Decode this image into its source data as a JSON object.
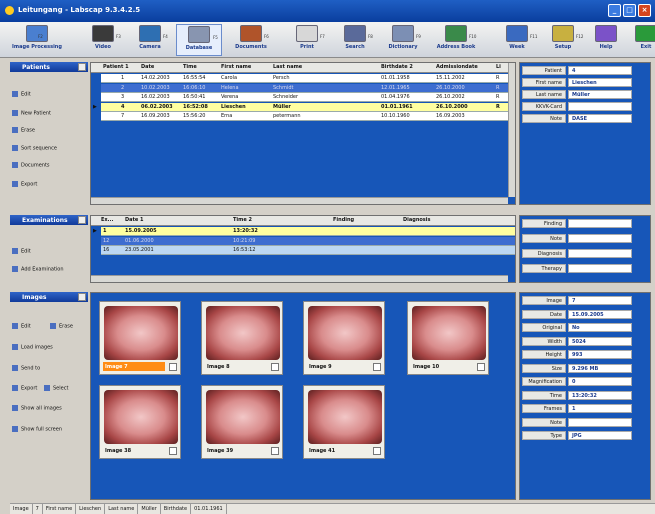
{
  "window": {
    "title": "Leitungang - Labscap 9.3.4.2.5"
  },
  "toolbar": [
    {
      "label": "Image Processing",
      "key": "F2",
      "icon": "image-processing-icon"
    },
    {
      "label": "Video",
      "key": "F3",
      "icon": "video-camera-icon"
    },
    {
      "label": "Camera",
      "key": "F4",
      "icon": "camera-icon"
    },
    {
      "label": "Database",
      "key": "F5",
      "icon": "database-icon"
    },
    {
      "label": "Documents",
      "key": "F6",
      "icon": "documents-icon"
    },
    {
      "label": "Print",
      "key": "F7",
      "icon": "print-icon"
    },
    {
      "label": "Search",
      "key": "F8",
      "icon": "search-icon"
    },
    {
      "label": "Dictionary",
      "key": "F9",
      "icon": "dictionary-icon"
    },
    {
      "label": "Address Book",
      "key": "F10",
      "icon": "address-book-icon"
    },
    {
      "label": "Week",
      "key": "F11",
      "icon": "calendar-icon"
    },
    {
      "label": "Setup",
      "key": "F12",
      "icon": "setup-icon"
    },
    {
      "label": "Help",
      "key": "",
      "icon": "help-icon"
    },
    {
      "label": "Exit",
      "key": "",
      "icon": "exit-icon"
    }
  ],
  "patients": {
    "header": "Patients",
    "nav": [
      {
        "label": "Edit",
        "icon": "edit-icon"
      },
      {
        "label": "New Patient",
        "icon": "new-patient-icon"
      },
      {
        "label": "Erase",
        "icon": "erase-icon"
      },
      {
        "label": "Sort sequence",
        "icon": "sort-icon"
      },
      {
        "label": "Documents",
        "icon": "documents-icon"
      },
      {
        "label": "Export",
        "icon": "export-icon"
      }
    ],
    "columns": [
      "Patient 1",
      "Date",
      "Time",
      "First name",
      "Last name",
      "Birthdate 2",
      "Admissiondate",
      "Li"
    ],
    "rows": [
      {
        "id": "1",
        "date": "14.02.2003",
        "time": "16:55:54",
        "first": "Carola",
        "last": "Persch",
        "birth": "01.01.1958",
        "adm": "15.11.2002",
        "li": "R",
        "style": "white"
      },
      {
        "id": "2",
        "date": "10.02.2003",
        "time": "16:06:10",
        "first": "Helena",
        "last": "Schmidt",
        "birth": "12.01.1965",
        "adm": "26.10.2000",
        "li": "R",
        "style": "sel"
      },
      {
        "id": "3",
        "date": "16.02.2003",
        "time": "16:50:41",
        "first": "Verena",
        "last": "Schneider",
        "birth": "01.04.1976",
        "adm": "26.10.2002",
        "li": "R",
        "style": "white"
      },
      {
        "id": "4",
        "date": "06.02.2003",
        "time": "16:52:08",
        "first": "Lieschen",
        "last": "Müller",
        "birth": "01.01.1961",
        "adm": "26.10.2000",
        "li": "R",
        "style": "yellow"
      },
      {
        "id": "7",
        "date": "16.09.2003",
        "time": "15:56:20",
        "first": "Erna",
        "last": "petermann",
        "birth": "10.10.1960",
        "adm": "16.09.2003",
        "li": "",
        "style": "white"
      }
    ]
  },
  "patient_detail": [
    {
      "k": "Patient",
      "v": "4"
    },
    {
      "k": "First name",
      "v": "Lieschen"
    },
    {
      "k": "Last name",
      "v": "Müller"
    },
    {
      "k": "KKVK-Card",
      "v": ""
    },
    {
      "k": "Note",
      "v": "DASE"
    }
  ],
  "examinations": {
    "header": "Examinations",
    "nav": [
      {
        "label": "Edit",
        "icon": "edit-icon"
      },
      {
        "label": "Add Examination",
        "icon": "add-icon"
      }
    ],
    "columns": [
      "Ex...",
      "Date 1",
      "Time 2",
      "Finding",
      "Diagnosis"
    ],
    "rows": [
      {
        "id": "1",
        "date": "15.09.2005",
        "time": "13:20:32",
        "style": "yellow"
      },
      {
        "id": "12",
        "date": "01.06.2000",
        "time": "10:21:09",
        "style": "sel"
      },
      {
        "id": "16",
        "date": "23.05.2001",
        "time": "16:53:12",
        "style": "lb"
      }
    ]
  },
  "exam_detail": [
    {
      "k": "Finding",
      "v": ""
    },
    {
      "k": "Note",
      "v": ""
    },
    {
      "k": "Diagnosis",
      "v": ""
    },
    {
      "k": "Therapy",
      "v": ""
    }
  ],
  "images": {
    "header": "Images",
    "nav": [
      {
        "label": "Edit",
        "icon": "edit-icon"
      },
      {
        "label": "Erase",
        "icon": "erase-icon"
      },
      {
        "label": "Load images",
        "icon": "load-images-icon"
      },
      {
        "label": "Send to",
        "icon": "send-to-icon"
      },
      {
        "label": "Export",
        "icon": "export-icon"
      },
      {
        "label": "Select",
        "icon": "select-icon"
      },
      {
        "label": "Show all images",
        "icon": "show-all-icon"
      },
      {
        "label": "Show full screen",
        "icon": "fullscreen-icon"
      }
    ],
    "items": [
      {
        "caption": "Image 7",
        "selected": true
      },
      {
        "caption": "Image 8",
        "selected": false
      },
      {
        "caption": "Image 9",
        "selected": false
      },
      {
        "caption": "Image 10",
        "selected": false
      },
      {
        "caption": "Image 38",
        "selected": false
      },
      {
        "caption": "Image 39",
        "selected": false
      },
      {
        "caption": "Image 41",
        "selected": false
      }
    ]
  },
  "image_detail": [
    {
      "k": "Image",
      "v": "7"
    },
    {
      "k": "Date",
      "v": "15.09.2005"
    },
    {
      "k": "Original",
      "v": "No"
    },
    {
      "k": "Width",
      "v": "5024"
    },
    {
      "k": "Height",
      "v": "993"
    },
    {
      "k": "Size",
      "v": "9.296 MB"
    },
    {
      "k": "Magnification",
      "v": "0"
    },
    {
      "k": "Time",
      "v": "13:20:32"
    },
    {
      "k": "Frames",
      "v": "1"
    },
    {
      "k": "Note",
      "v": ""
    },
    {
      "k": "Type",
      "v": "JPG"
    }
  ],
  "status": [
    {
      "label": "Image",
      "value": "7"
    },
    {
      "label": "First name",
      "value": "Lieschen"
    },
    {
      "label": "Last name",
      "value": "Müller"
    },
    {
      "label": "Birthdate",
      "value": "01.01.1961"
    }
  ]
}
